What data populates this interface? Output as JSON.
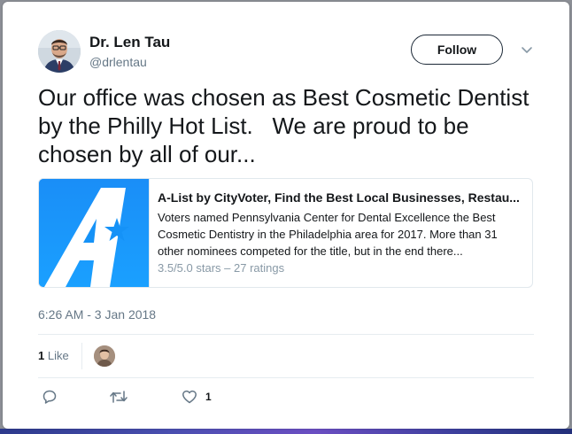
{
  "author": {
    "name": "Dr. Len Tau",
    "handle": "@drlentau"
  },
  "follow_button": {
    "label": "Follow"
  },
  "tweet": {
    "text": "Our office was chosen as Best Cosmetic Dentist by the Philly Hot List.   We are proud to be chosen by all of our..."
  },
  "link_card": {
    "title": "A-List by CityVoter, Find the Best Local Businesses, Restau...",
    "description": "Voters named Pennsylvania Center for Dental Excellence the Best Cosmetic Dentistry in the Philadelphia area for 2017. More than 31 other nominees competed for the title, but in the end there...",
    "rating": "3.5/5.0 stars – 27 ratings"
  },
  "timestamp": "6:26 AM - 3 Jan 2018",
  "stats": {
    "like_count": "1",
    "like_label": "Like"
  },
  "actions": {
    "reply_icon": "reply-icon",
    "retweet_icon": "retweet-icon",
    "like_icon": "heart-icon",
    "like_count": "1"
  },
  "colors": {
    "text_primary": "#14171a",
    "text_secondary": "#657786",
    "thumb_blue": "#1592f7",
    "border": "#e1e8ed"
  }
}
